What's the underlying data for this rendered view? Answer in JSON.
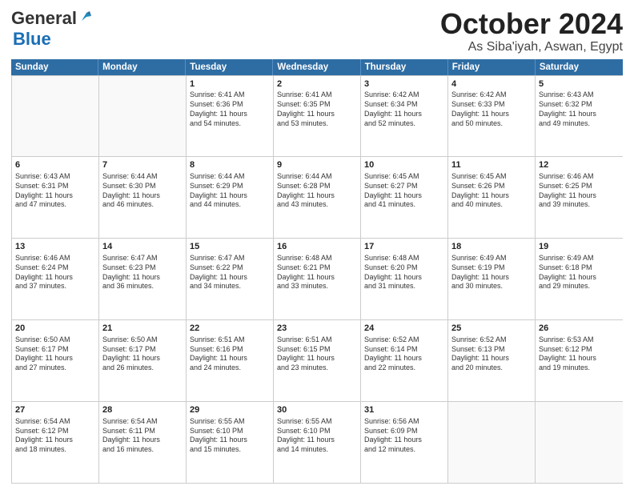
{
  "header": {
    "logo_general": "General",
    "logo_blue": "Blue",
    "month": "October 2024",
    "location": "As Siba'iyah, Aswan, Egypt"
  },
  "weekdays": [
    "Sunday",
    "Monday",
    "Tuesday",
    "Wednesday",
    "Thursday",
    "Friday",
    "Saturday"
  ],
  "weeks": [
    [
      {
        "day": "",
        "info": ""
      },
      {
        "day": "",
        "info": ""
      },
      {
        "day": "1",
        "info": "Sunrise: 6:41 AM\nSunset: 6:36 PM\nDaylight: 11 hours\nand 54 minutes."
      },
      {
        "day": "2",
        "info": "Sunrise: 6:41 AM\nSunset: 6:35 PM\nDaylight: 11 hours\nand 53 minutes."
      },
      {
        "day": "3",
        "info": "Sunrise: 6:42 AM\nSunset: 6:34 PM\nDaylight: 11 hours\nand 52 minutes."
      },
      {
        "day": "4",
        "info": "Sunrise: 6:42 AM\nSunset: 6:33 PM\nDaylight: 11 hours\nand 50 minutes."
      },
      {
        "day": "5",
        "info": "Sunrise: 6:43 AM\nSunset: 6:32 PM\nDaylight: 11 hours\nand 49 minutes."
      }
    ],
    [
      {
        "day": "6",
        "info": "Sunrise: 6:43 AM\nSunset: 6:31 PM\nDaylight: 11 hours\nand 47 minutes."
      },
      {
        "day": "7",
        "info": "Sunrise: 6:44 AM\nSunset: 6:30 PM\nDaylight: 11 hours\nand 46 minutes."
      },
      {
        "day": "8",
        "info": "Sunrise: 6:44 AM\nSunset: 6:29 PM\nDaylight: 11 hours\nand 44 minutes."
      },
      {
        "day": "9",
        "info": "Sunrise: 6:44 AM\nSunset: 6:28 PM\nDaylight: 11 hours\nand 43 minutes."
      },
      {
        "day": "10",
        "info": "Sunrise: 6:45 AM\nSunset: 6:27 PM\nDaylight: 11 hours\nand 41 minutes."
      },
      {
        "day": "11",
        "info": "Sunrise: 6:45 AM\nSunset: 6:26 PM\nDaylight: 11 hours\nand 40 minutes."
      },
      {
        "day": "12",
        "info": "Sunrise: 6:46 AM\nSunset: 6:25 PM\nDaylight: 11 hours\nand 39 minutes."
      }
    ],
    [
      {
        "day": "13",
        "info": "Sunrise: 6:46 AM\nSunset: 6:24 PM\nDaylight: 11 hours\nand 37 minutes."
      },
      {
        "day": "14",
        "info": "Sunrise: 6:47 AM\nSunset: 6:23 PM\nDaylight: 11 hours\nand 36 minutes."
      },
      {
        "day": "15",
        "info": "Sunrise: 6:47 AM\nSunset: 6:22 PM\nDaylight: 11 hours\nand 34 minutes."
      },
      {
        "day": "16",
        "info": "Sunrise: 6:48 AM\nSunset: 6:21 PM\nDaylight: 11 hours\nand 33 minutes."
      },
      {
        "day": "17",
        "info": "Sunrise: 6:48 AM\nSunset: 6:20 PM\nDaylight: 11 hours\nand 31 minutes."
      },
      {
        "day": "18",
        "info": "Sunrise: 6:49 AM\nSunset: 6:19 PM\nDaylight: 11 hours\nand 30 minutes."
      },
      {
        "day": "19",
        "info": "Sunrise: 6:49 AM\nSunset: 6:18 PM\nDaylight: 11 hours\nand 29 minutes."
      }
    ],
    [
      {
        "day": "20",
        "info": "Sunrise: 6:50 AM\nSunset: 6:17 PM\nDaylight: 11 hours\nand 27 minutes."
      },
      {
        "day": "21",
        "info": "Sunrise: 6:50 AM\nSunset: 6:17 PM\nDaylight: 11 hours\nand 26 minutes."
      },
      {
        "day": "22",
        "info": "Sunrise: 6:51 AM\nSunset: 6:16 PM\nDaylight: 11 hours\nand 24 minutes."
      },
      {
        "day": "23",
        "info": "Sunrise: 6:51 AM\nSunset: 6:15 PM\nDaylight: 11 hours\nand 23 minutes."
      },
      {
        "day": "24",
        "info": "Sunrise: 6:52 AM\nSunset: 6:14 PM\nDaylight: 11 hours\nand 22 minutes."
      },
      {
        "day": "25",
        "info": "Sunrise: 6:52 AM\nSunset: 6:13 PM\nDaylight: 11 hours\nand 20 minutes."
      },
      {
        "day": "26",
        "info": "Sunrise: 6:53 AM\nSunset: 6:12 PM\nDaylight: 11 hours\nand 19 minutes."
      }
    ],
    [
      {
        "day": "27",
        "info": "Sunrise: 6:54 AM\nSunset: 6:12 PM\nDaylight: 11 hours\nand 18 minutes."
      },
      {
        "day": "28",
        "info": "Sunrise: 6:54 AM\nSunset: 6:11 PM\nDaylight: 11 hours\nand 16 minutes."
      },
      {
        "day": "29",
        "info": "Sunrise: 6:55 AM\nSunset: 6:10 PM\nDaylight: 11 hours\nand 15 minutes."
      },
      {
        "day": "30",
        "info": "Sunrise: 6:55 AM\nSunset: 6:10 PM\nDaylight: 11 hours\nand 14 minutes."
      },
      {
        "day": "31",
        "info": "Sunrise: 6:56 AM\nSunset: 6:09 PM\nDaylight: 11 hours\nand 12 minutes."
      },
      {
        "day": "",
        "info": ""
      },
      {
        "day": "",
        "info": ""
      }
    ]
  ]
}
